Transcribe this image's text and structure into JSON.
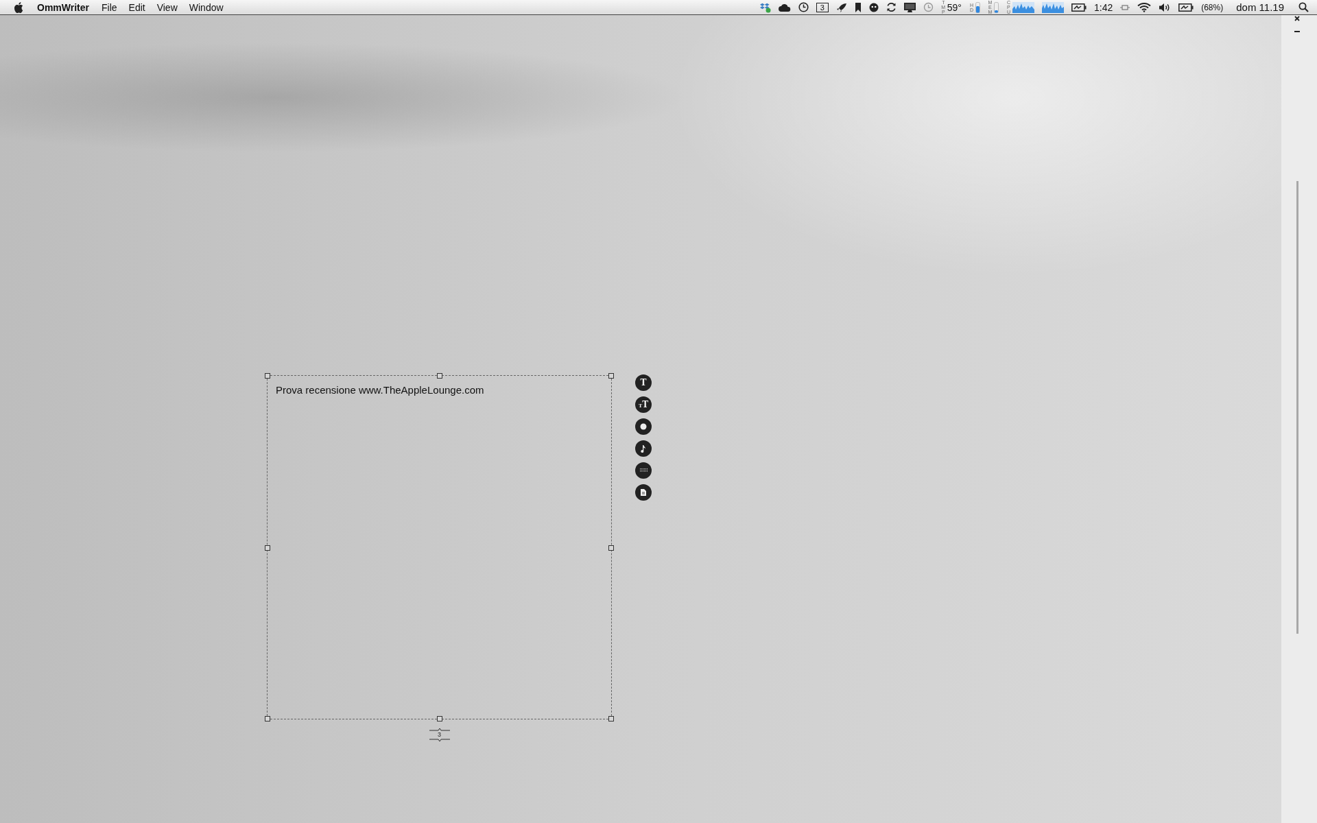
{
  "menu_bar": {
    "app_name": "OmmWriter",
    "menus": [
      "File",
      "Edit",
      "View",
      "Window"
    ],
    "status": {
      "spaces": "3",
      "meter_labels": [
        "TMP",
        "HD",
        "MEM",
        "CPU"
      ],
      "temperature": "59°",
      "battery_time": "1:42",
      "battery_percent": "(68%)",
      "clock": "dom 11.19"
    }
  },
  "document": {
    "text": "Prova recensione www.TheAppleLounge.com",
    "page": "3"
  },
  "tools": [
    {
      "kind": "font",
      "label": "T"
    },
    {
      "kind": "font-size",
      "small": "T",
      "large": "T"
    },
    {
      "kind": "background"
    },
    {
      "kind": "music"
    },
    {
      "kind": "keyboard"
    },
    {
      "kind": "export"
    }
  ]
}
